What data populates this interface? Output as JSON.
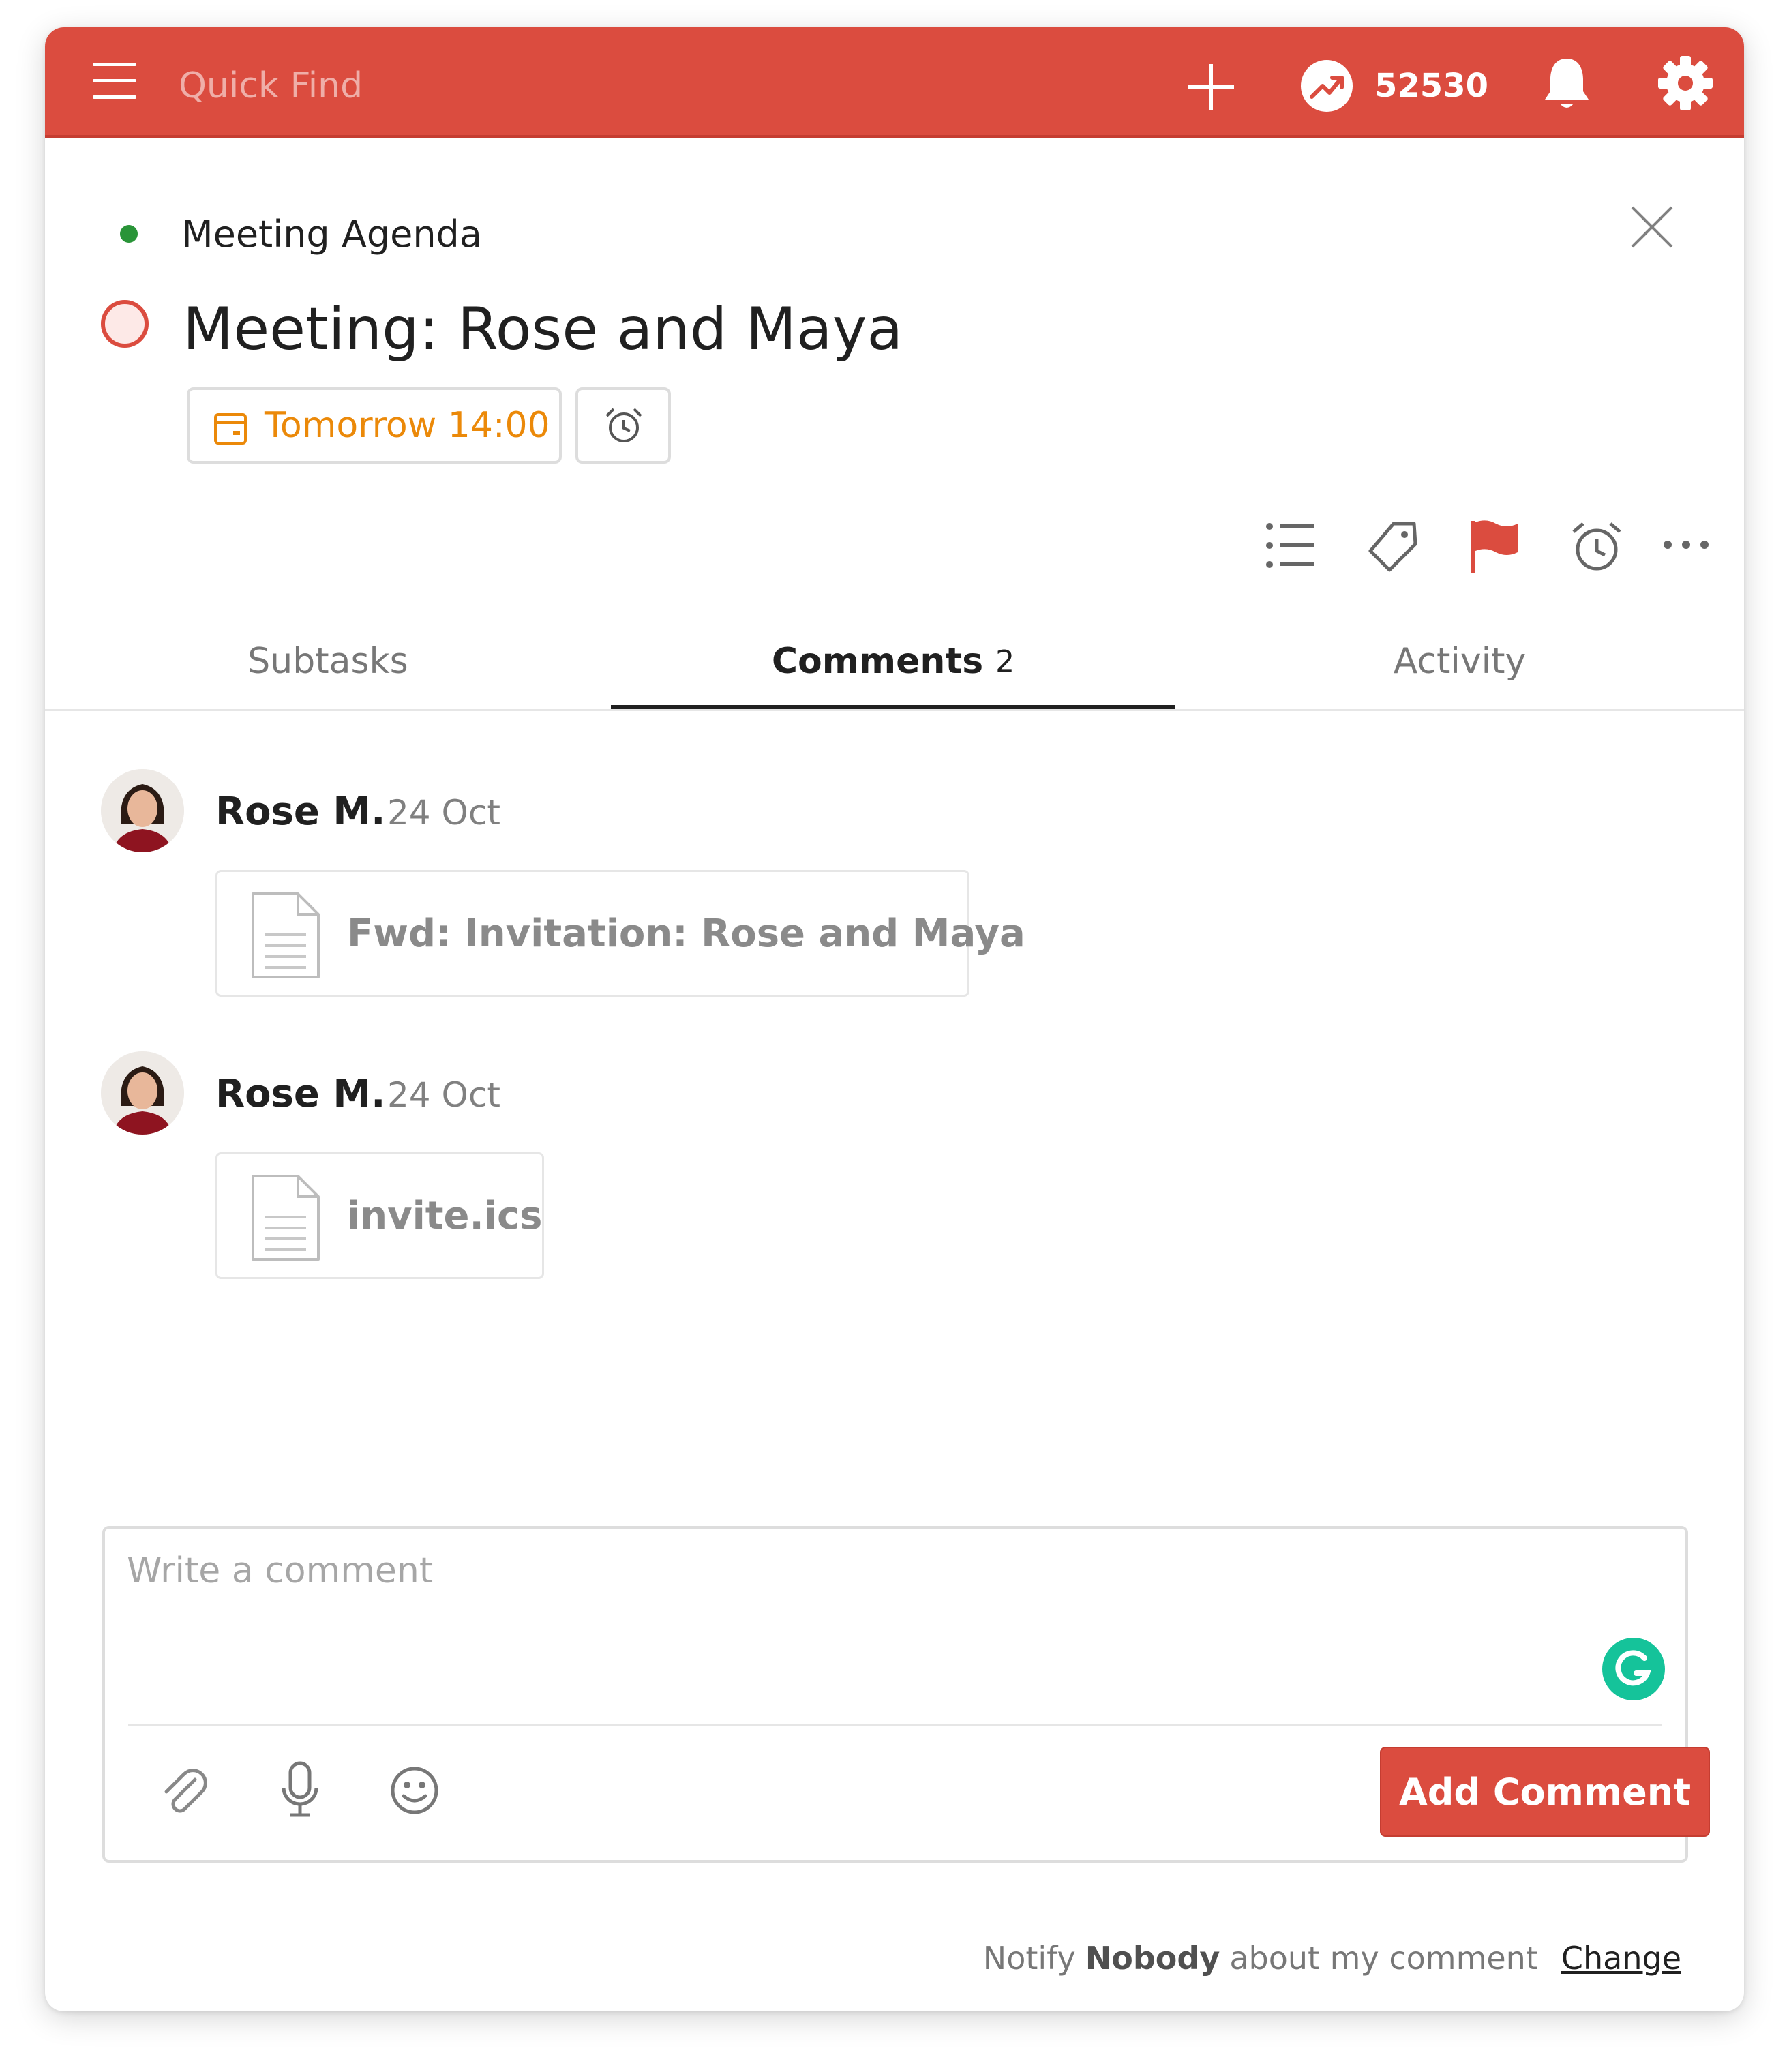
{
  "topbar": {
    "search_placeholder": "Quick Find",
    "karma_score": "52530",
    "menu_icon": "hamburger-menu-icon",
    "add_icon": "plus-icon",
    "karma_icon": "karma-trend-icon",
    "notifications_icon": "bell-icon",
    "settings_icon": "gear-icon"
  },
  "task": {
    "project": "Meeting Agenda",
    "project_color": "#299438",
    "title": "Meeting: Rose and Maya",
    "due": "Tomorrow 14:00",
    "due_color": "#eb8909",
    "priority_flag_color": "#db4c3f",
    "toolbar_icons": [
      "subtasks-list-icon",
      "label-tag-icon",
      "priority-flag-icon",
      "reminder-alarm-icon",
      "more-options-icon"
    ]
  },
  "tabs": [
    {
      "label": "Subtasks",
      "count": ""
    },
    {
      "label": "Comments",
      "count": "2"
    },
    {
      "label": "Activity",
      "count": ""
    }
  ],
  "comments": [
    {
      "author": "Rose M.",
      "date": "24 Oct",
      "attachment": "Fwd: Invitation: Rose and Maya"
    },
    {
      "author": "Rose M.",
      "date": "24 Oct",
      "attachment": "invite.ics"
    }
  ],
  "editor": {
    "placeholder": "Write a comment",
    "submit_label": "Add Comment",
    "footer_icons": [
      "paperclip-icon",
      "microphone-icon",
      "emoji-icon"
    ]
  },
  "notify": {
    "prefix": "Notify",
    "who": "Nobody",
    "suffix": "about my comment",
    "change_label": "Change"
  },
  "colors": {
    "brand": "#db4c3f",
    "text": "#202020",
    "muted": "#808080"
  }
}
